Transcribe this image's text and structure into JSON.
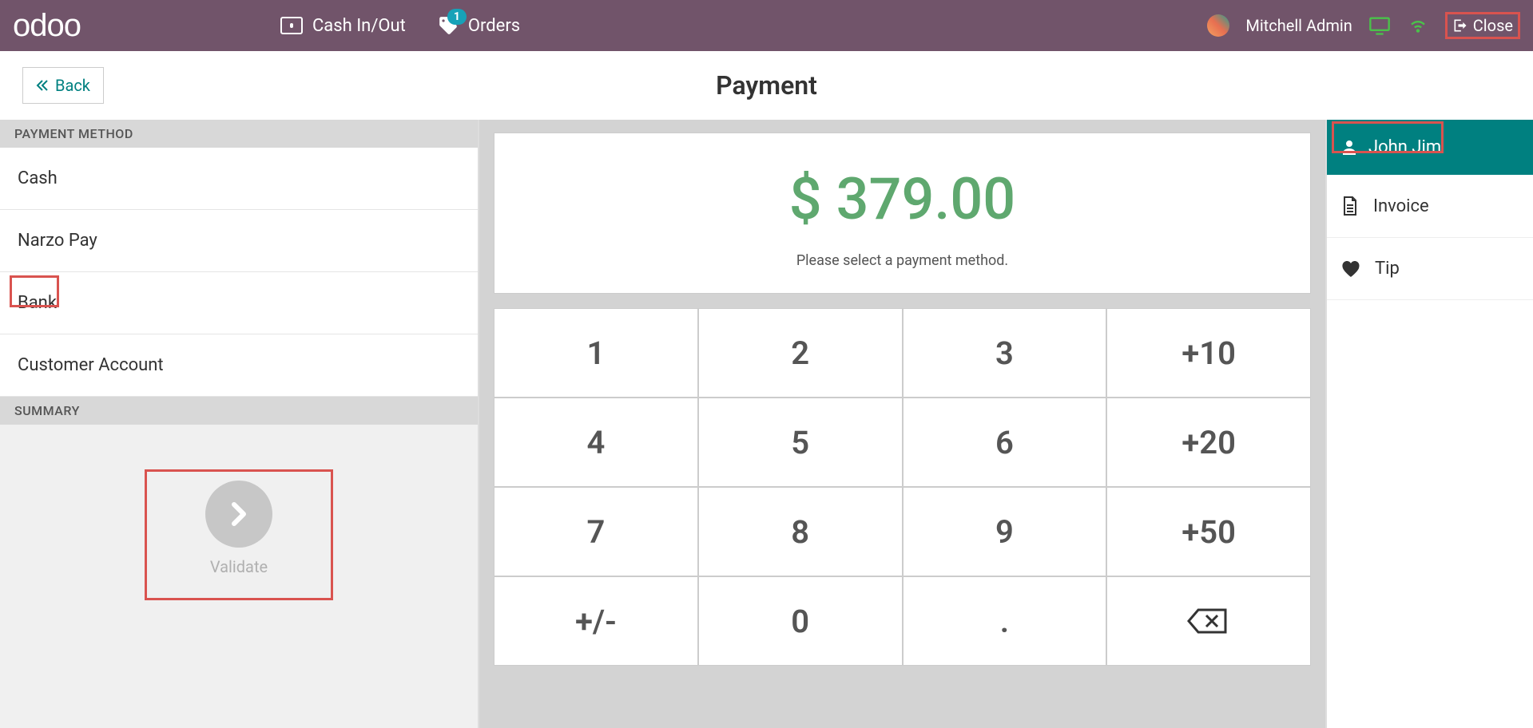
{
  "header": {
    "logo": "odoo",
    "cash_label": "Cash In/Out",
    "orders_label": "Orders",
    "orders_badge": "1",
    "user": "Mitchell Admin",
    "close": "Close"
  },
  "subheader": {
    "back": "Back",
    "title": "Payment"
  },
  "left": {
    "section_method": "PAYMENT METHOD",
    "methods": [
      "Cash",
      "Narzo Pay",
      "Bank",
      "Customer Account"
    ],
    "section_summary": "SUMMARY",
    "validate": "Validate"
  },
  "center": {
    "amount": "$ 379.00",
    "hint": "Please select a payment method.",
    "keys": [
      "1",
      "2",
      "3",
      "+10",
      "4",
      "5",
      "6",
      "+20",
      "7",
      "8",
      "9",
      "+50",
      "+/-",
      "0",
      ".",
      "⌫"
    ]
  },
  "right": {
    "customer": "John Jim",
    "invoice": "Invoice",
    "tip": "Tip"
  }
}
